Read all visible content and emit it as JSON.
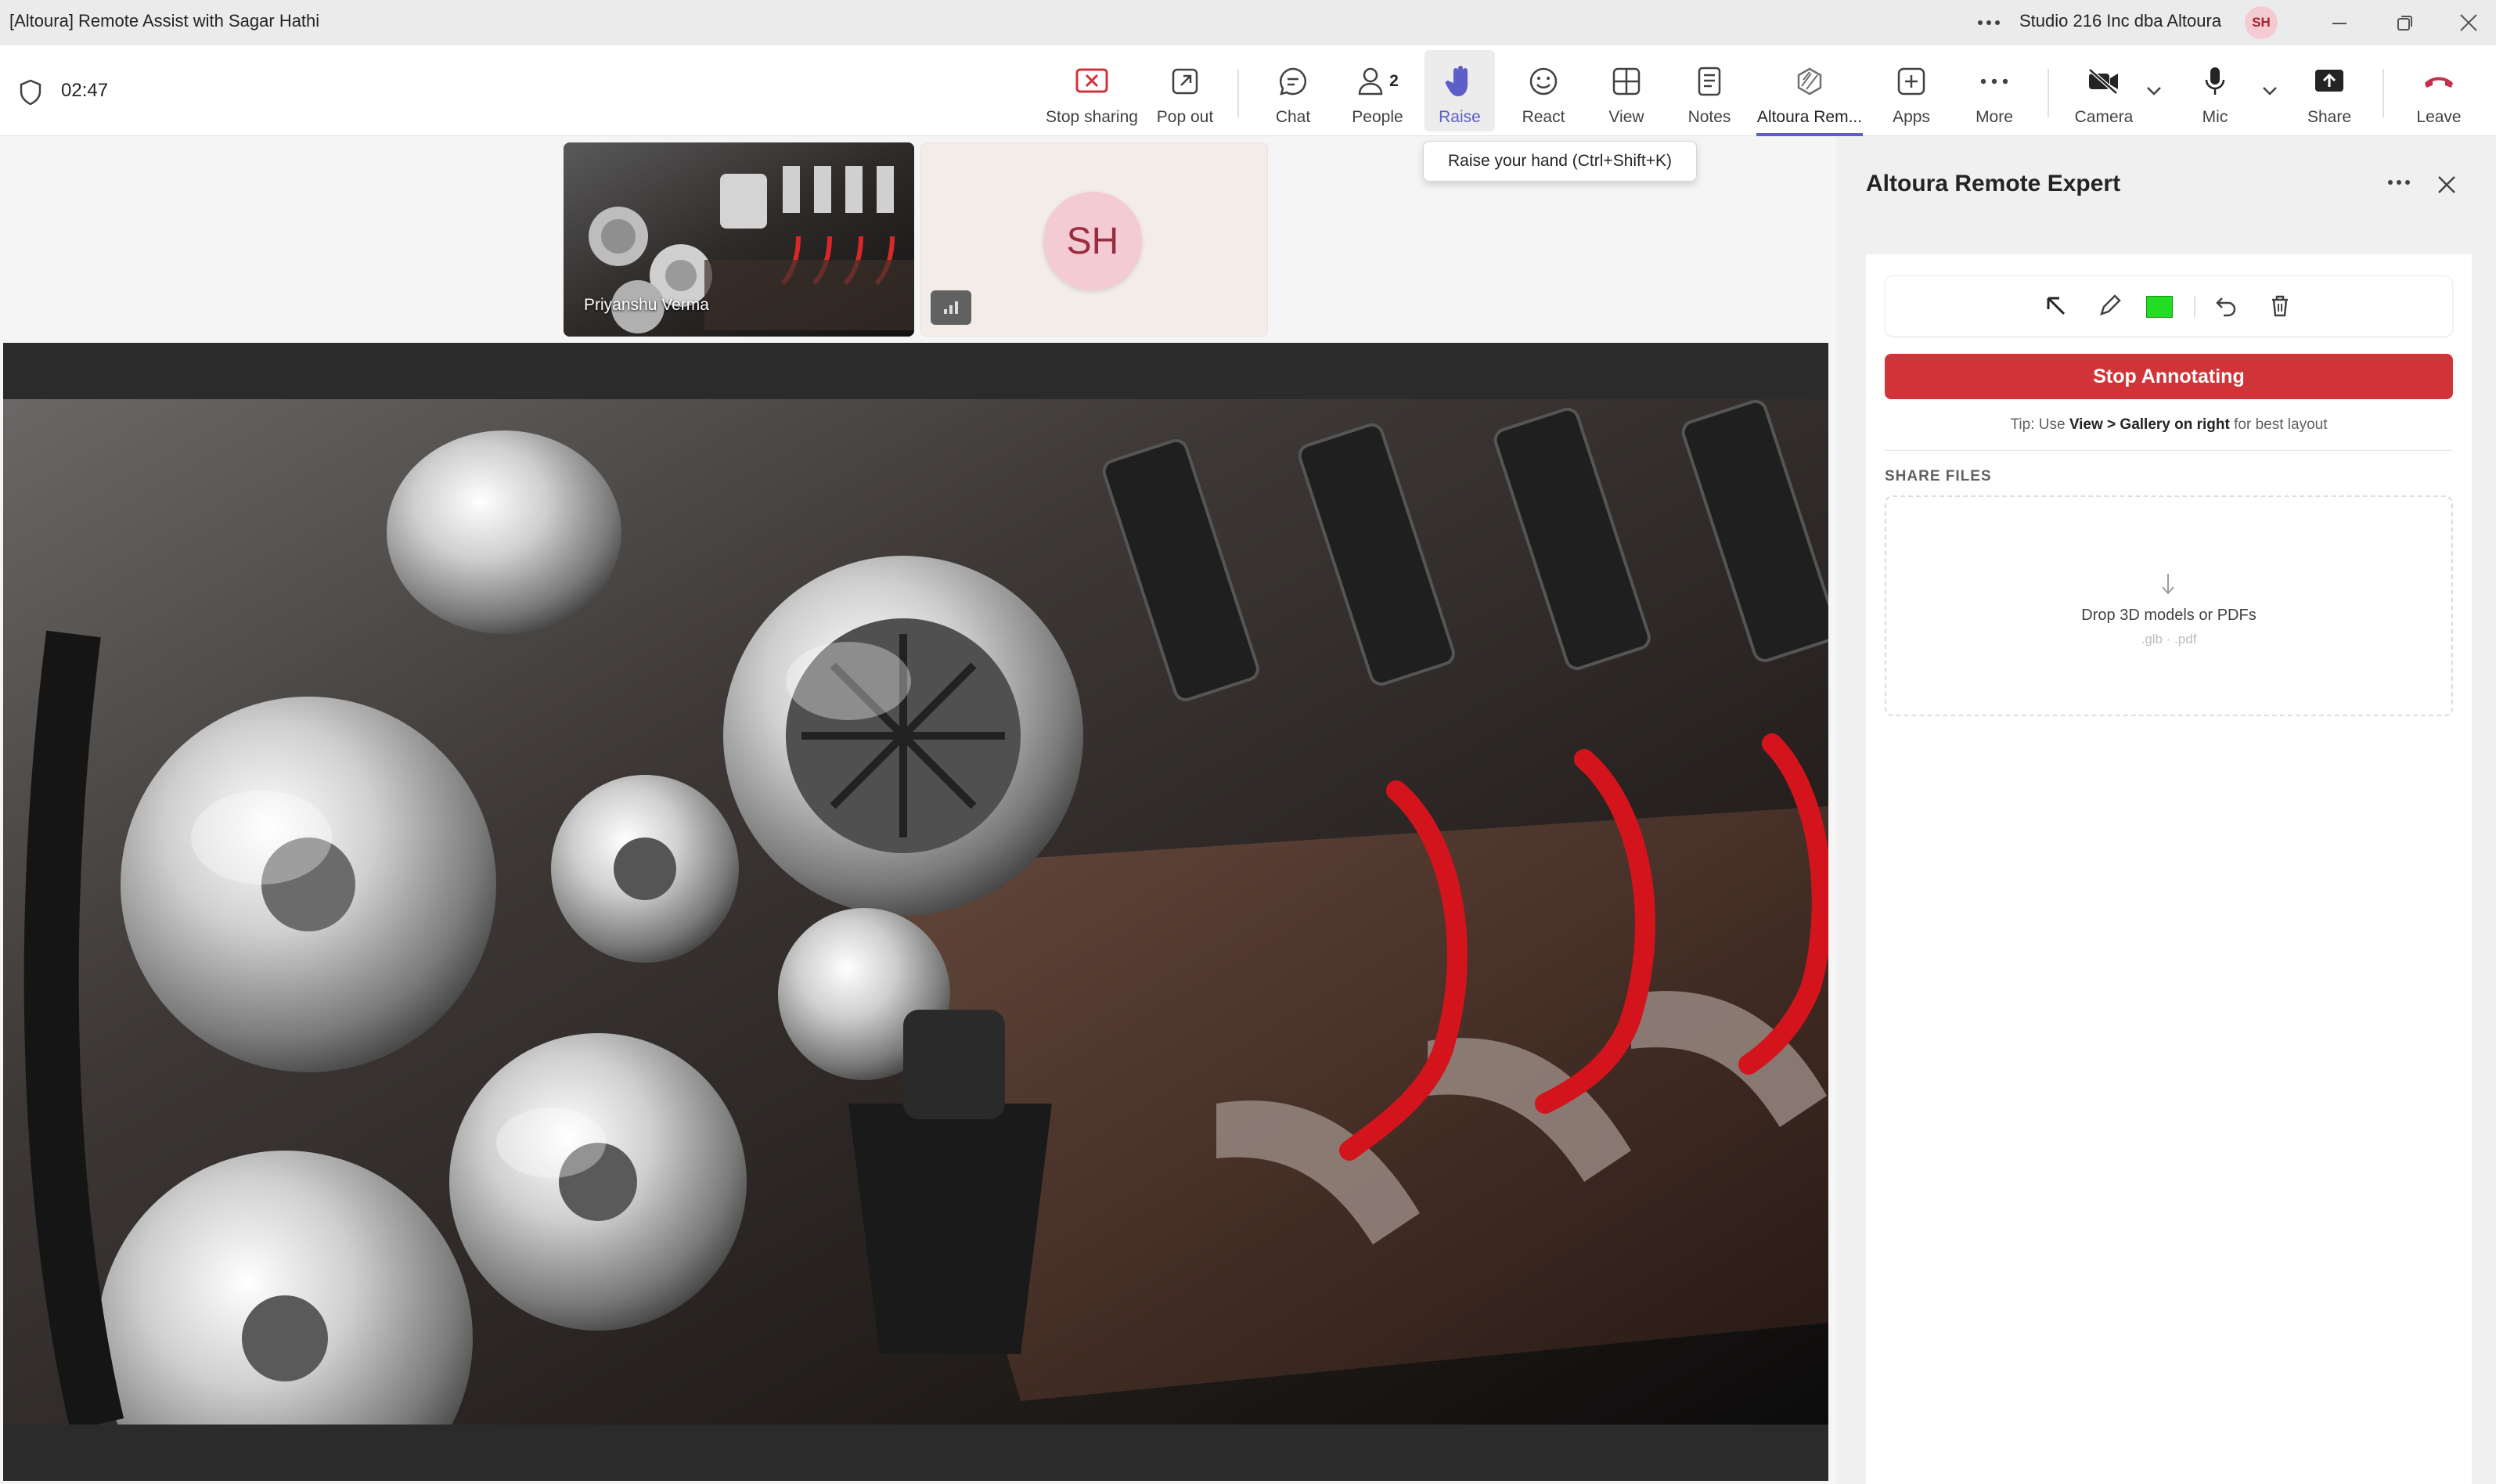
{
  "window": {
    "title": "[Altoura] Remote Assist with Sagar Hathi",
    "org": "Studio 216 Inc dba Altoura",
    "avatar_initials": "SH"
  },
  "meeting": {
    "timer": "02:47",
    "tools": {
      "stop_sharing": "Stop sharing",
      "pop_out": "Pop out",
      "chat": "Chat",
      "people": "People",
      "people_count": "2",
      "raise": "Raise",
      "react": "React",
      "view": "View",
      "notes": "Notes",
      "altoura": "Altoura Rem...",
      "apps": "Apps",
      "more": "More",
      "camera": "Camera",
      "mic": "Mic",
      "share": "Share",
      "leave": "Leave"
    },
    "tooltip": "Raise your hand (Ctrl+Shift+K)"
  },
  "participants": [
    {
      "name": "Priyanshu Verma"
    },
    {
      "initials": "SH"
    }
  ],
  "panel": {
    "title": "Altoura Remote Expert",
    "annotation_color": "#22dd22",
    "stop_button": "Stop Annotating",
    "tip_prefix": "Tip: Use ",
    "tip_bold": "View > Gallery on right",
    "tip_suffix": " for best layout",
    "share_files_heading": "SHARE FILES",
    "drop_text": "Drop 3D models or PDFs",
    "drop_formats": ".glb · .pdf"
  },
  "colors": {
    "accent": "#5b5fc7",
    "stop_red": "#d13438",
    "leave_red": "#c4314b"
  }
}
